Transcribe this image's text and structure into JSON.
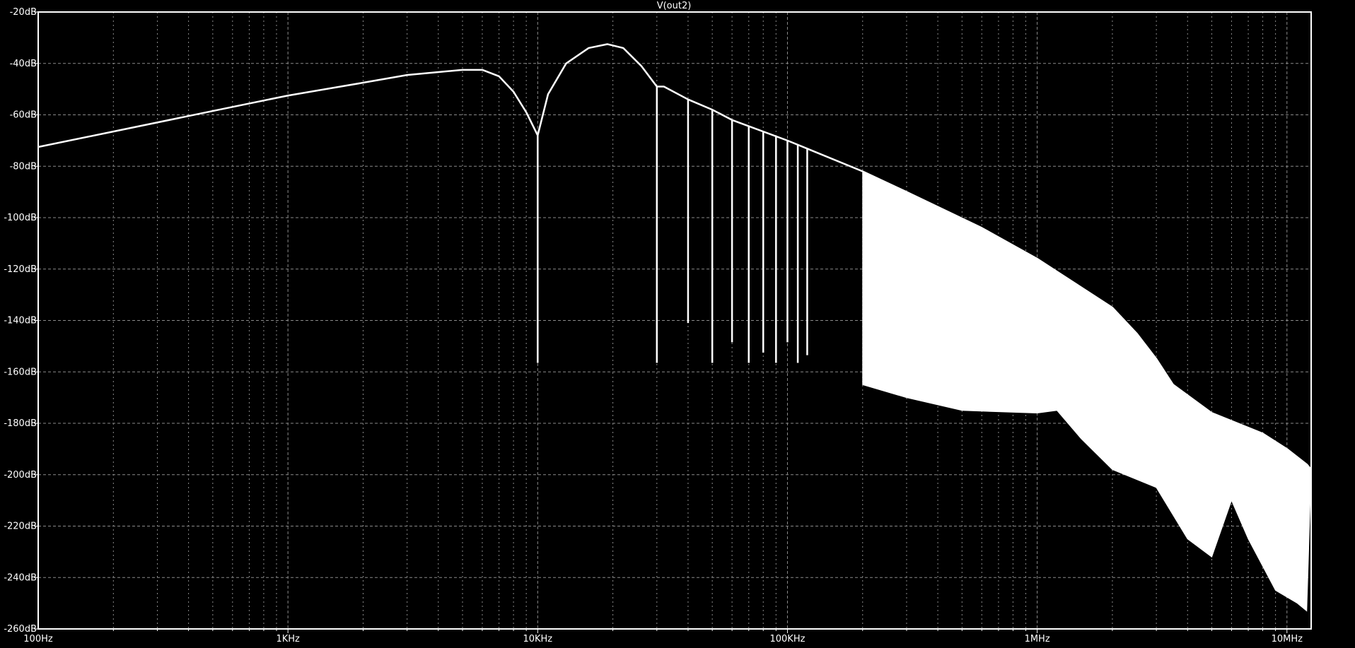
{
  "chart_data": {
    "type": "line",
    "title": "V(out2)",
    "xlabel": "",
    "ylabel": "",
    "x_scale": "log",
    "y_unit": "dB",
    "xlim": [
      100,
      12500000
    ],
    "ylim": [
      -260,
      -20
    ],
    "x_ticks": [
      100,
      1000,
      10000,
      100000,
      1000000,
      10000000
    ],
    "x_tick_labels": [
      "100Hz",
      "1KHz",
      "10KHz",
      "100KHz",
      "1MHz",
      "10MHz"
    ],
    "y_ticks": [
      -20,
      -40,
      -60,
      -80,
      -100,
      -120,
      -140,
      -160,
      -180,
      -200,
      -220,
      -240,
      -260
    ],
    "y_tick_labels": [
      "-20dB",
      "-40dB",
      "-60dB",
      "-80dB",
      "-100dB",
      "-120dB",
      "-140dB",
      "-160dB",
      "-180dB",
      "-200dB",
      "-220dB",
      "-240dB",
      "-260dB"
    ],
    "grid": true,
    "grid_style": "dashed",
    "colors": {
      "background": "#000000",
      "trace": "#ffffff",
      "grid": "#8a8a8a",
      "axis": "#ffffff",
      "text": "#ffffff"
    },
    "series": [
      {
        "envelope_upper": [
          [
            100,
            -72.5
          ],
          [
            200,
            -66.5
          ],
          [
            500,
            -58.5
          ],
          [
            1000,
            -52.5
          ],
          [
            2000,
            -47.5
          ],
          [
            3000,
            -44.5
          ],
          [
            5000,
            -42.5
          ],
          [
            6000,
            -42.5
          ],
          [
            7000,
            -45
          ],
          [
            8000,
            -51
          ],
          [
            9000,
            -59
          ],
          [
            10000,
            -68
          ],
          [
            11000,
            -52
          ],
          [
            13000,
            -40
          ],
          [
            16000,
            -34
          ],
          [
            19000,
            -32.5
          ],
          [
            22000,
            -34
          ],
          [
            26000,
            -41
          ],
          [
            30000,
            -49
          ],
          [
            32000,
            -49
          ],
          [
            40000,
            -54
          ],
          [
            50000,
            -58
          ],
          [
            60000,
            -62
          ],
          [
            100000,
            -70
          ],
          [
            200000,
            -82
          ],
          [
            300000,
            -90
          ],
          [
            600000,
            -104
          ],
          [
            1000000,
            -116
          ],
          [
            2000000,
            -135
          ],
          [
            2500000,
            -145
          ],
          [
            3000000,
            -155
          ],
          [
            3500000,
            -165
          ],
          [
            5000000,
            -176
          ],
          [
            8000000,
            -184
          ],
          [
            10000000,
            -190
          ],
          [
            12000000,
            -196
          ],
          [
            12500000,
            -198
          ]
        ],
        "envelope_lower": [
          [
            200000,
            -165
          ],
          [
            300000,
            -170
          ],
          [
            500000,
            -175
          ],
          [
            1000000,
            -176
          ],
          [
            1200000,
            -175
          ],
          [
            1500000,
            -186
          ],
          [
            2000000,
            -198
          ],
          [
            3000000,
            -205
          ],
          [
            4000000,
            -225
          ],
          [
            5000000,
            -232
          ],
          [
            6000000,
            -210
          ],
          [
            7000000,
            -225
          ],
          [
            9000000,
            -245
          ],
          [
            11000000,
            -250
          ],
          [
            12000000,
            -253
          ]
        ],
        "nulls": [
          {
            "x": 10000,
            "y": -156.5
          },
          {
            "x": 30000,
            "y": -156.5
          },
          {
            "x": 40000,
            "y": -141
          },
          {
            "x": 50000,
            "y": -156.5
          },
          {
            "x": 60000,
            "y": -148.5
          },
          {
            "x": 70000,
            "y": -156.5
          },
          {
            "x": 80000,
            "y": -152.5
          },
          {
            "x": 90000,
            "y": -156.5
          },
          {
            "x": 100000,
            "y": -148.5
          },
          {
            "x": 110000,
            "y": -156.5
          },
          {
            "x": 120000,
            "y": -153.5
          }
        ]
      }
    ]
  }
}
